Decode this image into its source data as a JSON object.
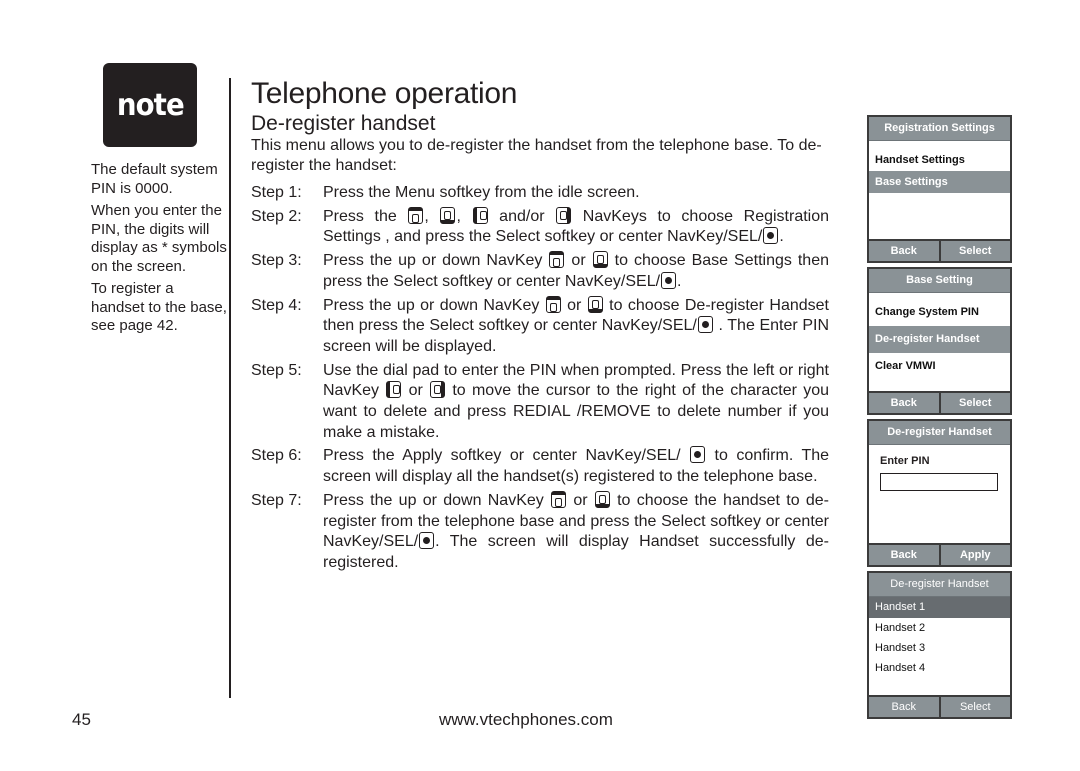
{
  "note": {
    "badge": "note",
    "paragraphs": [
      "The default system PIN is 0000.",
      "When you enter the PIN, the digits will display as * symbols on the screen.",
      "To register a handset to the base, see page 42."
    ]
  },
  "header": {
    "title": "Telephone operation",
    "subtitle": "De-register handset"
  },
  "intro": "This menu allows you to de-register the handset from the telephone base. To de-register the handset:",
  "steps": [
    {
      "label": "Step 1:",
      "parts": [
        "Press the Menu softkey from the idle screen."
      ]
    },
    {
      "label": "Step 2:",
      "parts": [
        "Press the ",
        "up-navkey",
        ", ",
        "down-navkey",
        ", ",
        "left-navkey",
        " and/or ",
        "right-navkey",
        " NavKeys to choose Registration Settings , and press the Select softkey or center NavKey/SEL/",
        "sel-navkey",
        "."
      ]
    },
    {
      "label": "Step 3:",
      "parts": [
        "Press the up or down NavKey ",
        "up-navkey",
        " or ",
        "down-navkey",
        " to choose Base Settings then press the Select softkey or center NavKey/SEL/",
        "sel-navkey",
        "."
      ]
    },
    {
      "label": "Step 4:",
      "parts": [
        "Press the up or down NavKey ",
        "up-navkey",
        " or ",
        "down-navkey",
        " to choose De-register Handset then press the Select softkey or center NavKey/SEL/",
        "sel-navkey",
        " . The Enter PIN screen will be displayed."
      ]
    },
    {
      "label": "Step 5:",
      "parts": [
        "Use the dial pad to enter the PIN when prompted. Press the left or right NavKey ",
        "left-navkey",
        " or ",
        "right-navkey",
        " to move the cursor to the right of the character you want to delete and press REDIAL /REMOVE to delete number if you make a mistake."
      ]
    },
    {
      "label": "Step 6:",
      "parts": [
        "Press the Apply softkey or center NavKey/SEL/ ",
        "sel-navkey",
        " to confirm. The screen will display all the handset(s) registered to the telephone base."
      ]
    },
    {
      "label": "Step 7:",
      "parts": [
        "Press the up or down NavKey ",
        "up-navkey",
        " or ",
        "down-navkey",
        " to choose the handset to de-register from the telephone base and press the Select softkey or center NavKey/SEL/",
        "sel-navkey",
        ". The screen will display Handset successfully de-registered."
      ]
    }
  ],
  "screens": [
    {
      "title": "Registration Settings",
      "items": [
        "Handset Settings",
        "Base Settings"
      ],
      "selected": 1,
      "left": "Back",
      "right": "Select"
    },
    {
      "title": "Base Setting",
      "items": [
        "Change System PIN",
        "De-register Handset",
        "Clear VMWI"
      ],
      "selected": 1,
      "left": "Back",
      "right": "Select"
    },
    {
      "title": "De-register Handset",
      "label": "Enter PIN",
      "pin_value": "",
      "left": "Back",
      "right": "Apply"
    },
    {
      "title": "De-register Handset",
      "items": [
        "Handset  1",
        "Handset  2",
        "Handset  3",
        "Handset  4"
      ],
      "selected": 0,
      "left": "Back",
      "right": "Select"
    }
  ],
  "footer": {
    "page_number": "45",
    "url": "www.vtechphones.com"
  }
}
